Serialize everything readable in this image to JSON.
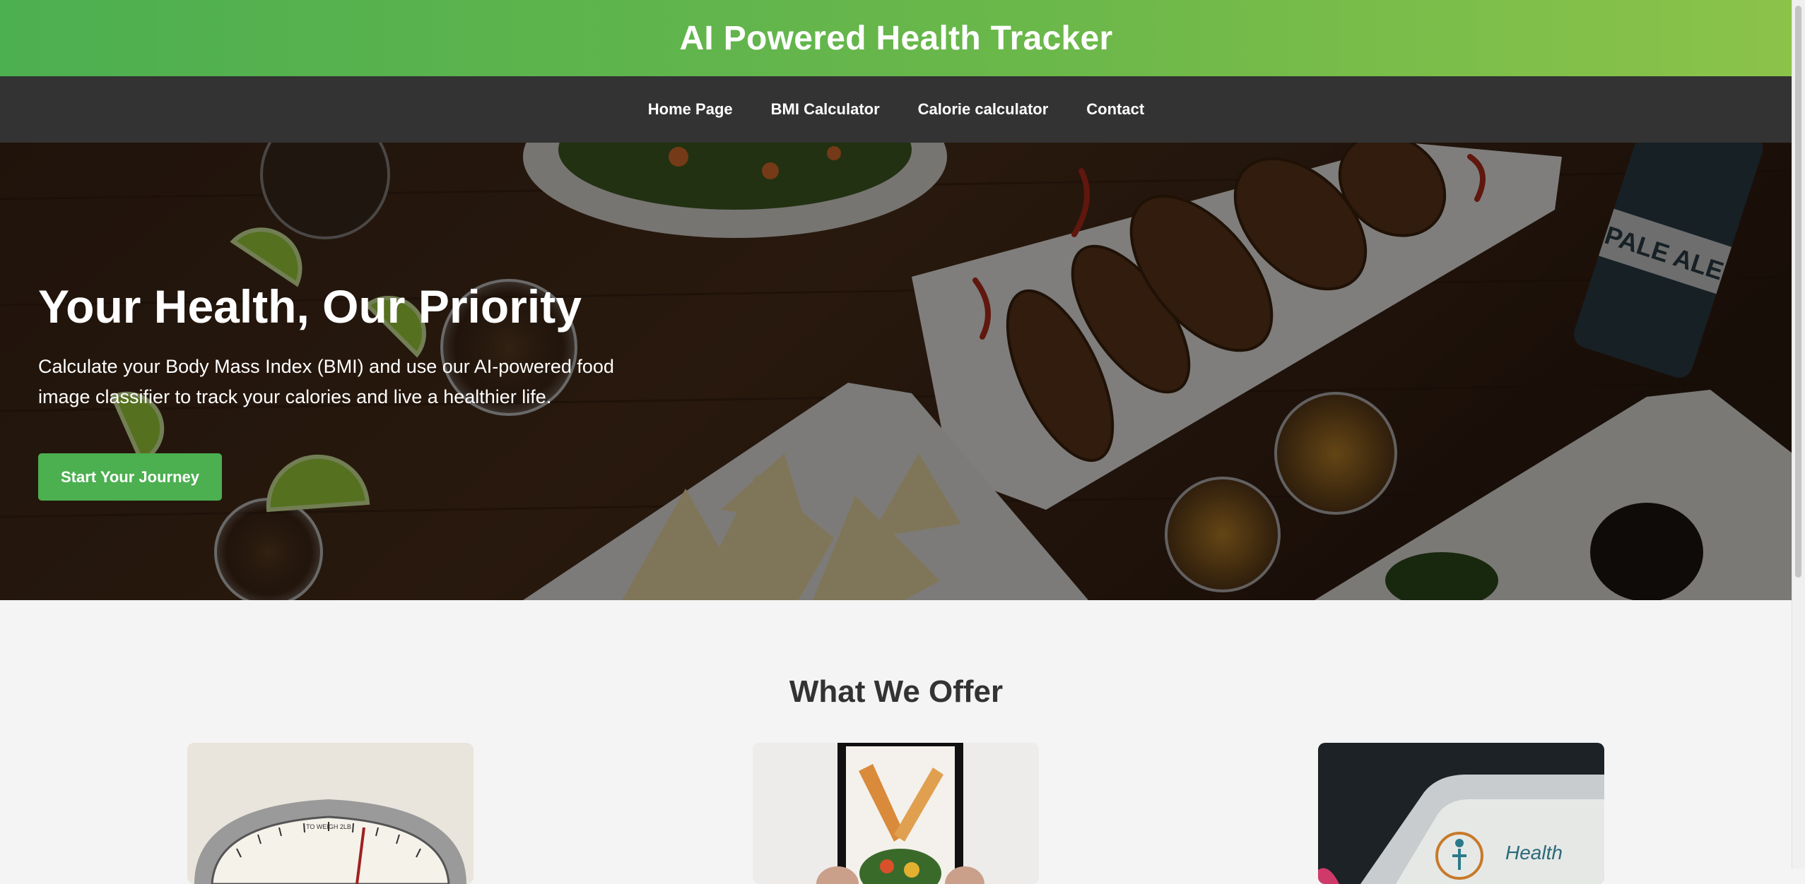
{
  "header": {
    "title": "AI Powered Health Tracker"
  },
  "nav": {
    "items": [
      "Home Page",
      "BMI Calculator",
      "Calorie calculator",
      "Contact"
    ]
  },
  "hero": {
    "title": "Your Health, Our Priority",
    "description": "Calculate your Body Mass Index (BMI) and use our AI-powered food image classifier to track your calories and live a healthier life.",
    "cta_label": "Start Your Journey",
    "can_text": "PALE ALE"
  },
  "offers": {
    "title": "What We Offer",
    "card_texts": {
      "scale": "TO WEIGH 2LB",
      "tracker": "Health"
    }
  },
  "colors": {
    "brand_green": "#4caf50",
    "nav_bg": "#333333",
    "page_bg": "#f4f4f4"
  }
}
